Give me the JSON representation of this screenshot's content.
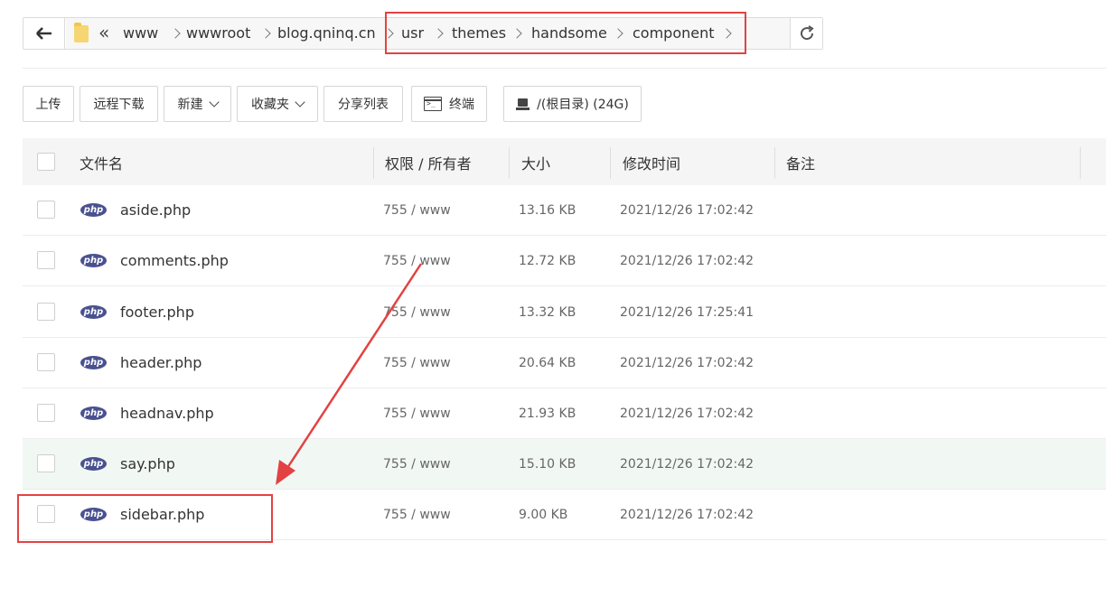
{
  "address_bar": {
    "crumbs": [
      "www",
      "wwwroot",
      "blog.qninq.cn",
      "usr",
      "themes",
      "handsome",
      "component"
    ]
  },
  "toolbar": {
    "upload": "上传",
    "remote_download": "远程下载",
    "new": "新建",
    "favorites": "收藏夹",
    "share_list": "分享列表",
    "terminal": "终端",
    "disk": "/(根目录) (24G)"
  },
  "table": {
    "headers": {
      "name": "文件名",
      "permission": "权限 / 所有者",
      "size": "大小",
      "modified": "修改时间",
      "note": "备注"
    },
    "rows": [
      {
        "icon": "php",
        "name": "aside.php",
        "permission": "755 / www",
        "size": "13.16 KB",
        "modified": "2021/12/26 17:02:42"
      },
      {
        "icon": "php",
        "name": "comments.php",
        "permission": "755 / www",
        "size": "12.72 KB",
        "modified": "2021/12/26 17:02:42"
      },
      {
        "icon": "php",
        "name": "footer.php",
        "permission": "755 / www",
        "size": "13.32 KB",
        "modified": "2021/12/26 17:25:41"
      },
      {
        "icon": "php",
        "name": "header.php",
        "permission": "755 / www",
        "size": "20.64 KB",
        "modified": "2021/12/26 17:02:42"
      },
      {
        "icon": "php",
        "name": "headnav.php",
        "permission": "755 / www",
        "size": "21.93 KB",
        "modified": "2021/12/26 17:02:42"
      },
      {
        "icon": "php",
        "name": "say.php",
        "permission": "755 / www",
        "size": "15.10 KB",
        "modified": "2021/12/26 17:02:42"
      },
      {
        "icon": "php",
        "name": "sidebar.php",
        "permission": "755 / www",
        "size": "9.00 KB",
        "modified": "2021/12/26 17:02:42"
      }
    ]
  },
  "colors": {
    "annotation_red": "#e34242",
    "php_icon": "#4a5190",
    "row_hover": "#f1f8f4"
  }
}
